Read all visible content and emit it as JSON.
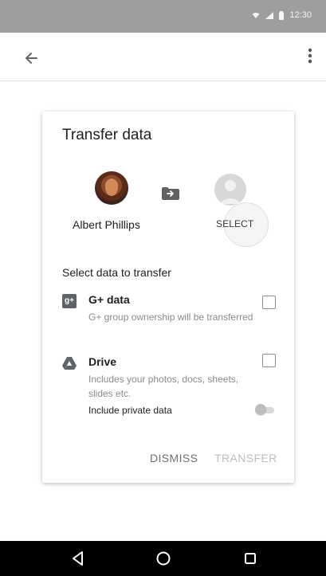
{
  "status_bar": {
    "time": "12:30"
  },
  "dialog": {
    "title": "Transfer data",
    "source_name": "Albert Phillips",
    "select_label": "SELECT",
    "section_title": "Select data to transfer",
    "items": [
      {
        "title": "G+ data",
        "icon": "google-plus-icon",
        "description": "G+ group ownership will be transferred",
        "checked": false
      },
      {
        "title": "Drive",
        "icon": "drive-icon",
        "description": "Includes your photos, docs, sheets, slides etc.",
        "checked": false
      }
    ],
    "private_label": "Include private data",
    "private_enabled": false,
    "dismiss_label": "DISMISS",
    "transfer_label": "TRANSFER"
  },
  "icons": {
    "back": "arrow-back-icon",
    "overflow": "more-vert-icon",
    "transfer": "forward-arrow-icon",
    "nav_back": "triangle-back-icon",
    "nav_home": "circle-home-icon",
    "nav_recents": "square-recents-icon"
  },
  "colors": {
    "status_bar": "#9e9e9e",
    "app_bar": "#ffffff",
    "card": "#ffffff",
    "text_primary": "#212121",
    "text_secondary": "#8a8a8a",
    "nav_bar": "#000000"
  }
}
